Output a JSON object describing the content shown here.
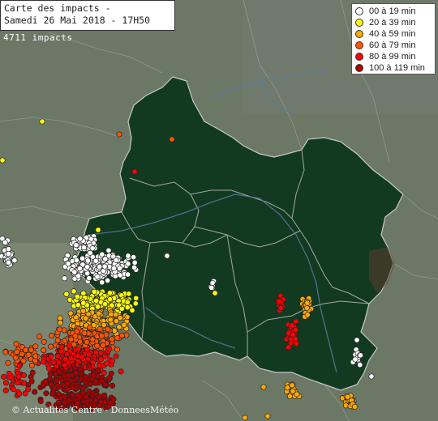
{
  "title": {
    "line1": "Carte des impacts -",
    "line2": "Samedi 26 Mai 2018 - 17H50"
  },
  "impact_count": "4711 impacts",
  "legend": [
    {
      "label": "00 à 19 min",
      "color": "#ffffff"
    },
    {
      "label": "20 à 39 min",
      "color": "#ffff00"
    },
    {
      "label": "40 à 59 min",
      "color": "#ffaa00"
    },
    {
      "label": "60 à 79 min",
      "color": "#ff5500"
    },
    {
      "label": "80 à 99 min",
      "color": "#ff0000"
    },
    {
      "label": "100 à 119 min",
      "color": "#aa0000"
    }
  ],
  "credit": "© Actualités Centre - DonneesMétéo",
  "colors": {
    "background": "#6e7a6a",
    "region": "#123a20",
    "borders": "#b9b9b9",
    "rivers": "#5a78a0"
  }
}
